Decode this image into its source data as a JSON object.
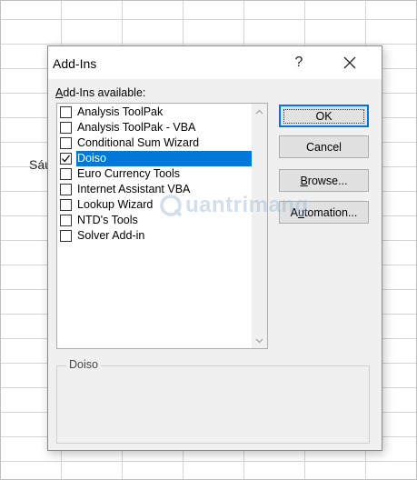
{
  "background": {
    "cell_text": "Sáu"
  },
  "dialog": {
    "title": "Add-Ins",
    "help_label": "?",
    "list_label_prefix": "",
    "list_label_mnemonic": "A",
    "list_label_rest": "dd-Ins available:",
    "items": [
      {
        "label": "Analysis ToolPak",
        "checked": false,
        "selected": false
      },
      {
        "label": "Analysis ToolPak - VBA",
        "checked": false,
        "selected": false
      },
      {
        "label": "Conditional Sum Wizard",
        "checked": false,
        "selected": false
      },
      {
        "label": "Doiso",
        "checked": true,
        "selected": true
      },
      {
        "label": "Euro Currency Tools",
        "checked": false,
        "selected": false
      },
      {
        "label": "Internet Assistant VBA",
        "checked": false,
        "selected": false
      },
      {
        "label": "Lookup Wizard",
        "checked": false,
        "selected": false
      },
      {
        "label": "NTD's Tools",
        "checked": false,
        "selected": false
      },
      {
        "label": "Solver Add-in",
        "checked": false,
        "selected": false
      }
    ],
    "buttons": {
      "ok": "OK",
      "cancel": "Cancel",
      "browse_mnemonic": "B",
      "browse_rest": "rowse...",
      "automation_mnemonic": "u",
      "automation_pre": "A",
      "automation_rest": "tomation..."
    },
    "description_title": "Doiso"
  },
  "watermark": {
    "text": "uantrimang"
  },
  "colors": {
    "selection": "#0078d7",
    "dialog_bg": "#f0f0f0",
    "button_bg": "#e1e1e1"
  }
}
